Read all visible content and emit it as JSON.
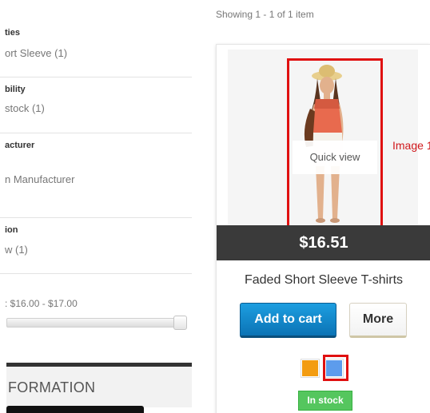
{
  "filters": [
    {
      "title": "ties",
      "value": "ort Sleeve (1)"
    },
    {
      "title": "bility",
      "value": "stock (1)"
    },
    {
      "title": "acturer",
      "value": "n Manufacturer"
    },
    {
      "title": "ion",
      "value": "w (1)"
    }
  ],
  "price_filter": {
    "label": ": $16.00 - $17.00"
  },
  "info_block": {
    "title": "FORMATION"
  },
  "listing": {
    "showing_text": "Showing 1 - 1 of 1 item"
  },
  "product": {
    "image_annotation": "Image 1",
    "quick_view_label": "Quick view",
    "price": "$16.51",
    "name": "Faded Short Sleeve T-shirts",
    "add_to_cart_label": "Add to cart",
    "more_label": "More",
    "availability": "In stock",
    "colors": [
      "#f39c11",
      "#5d9cec"
    ]
  }
}
